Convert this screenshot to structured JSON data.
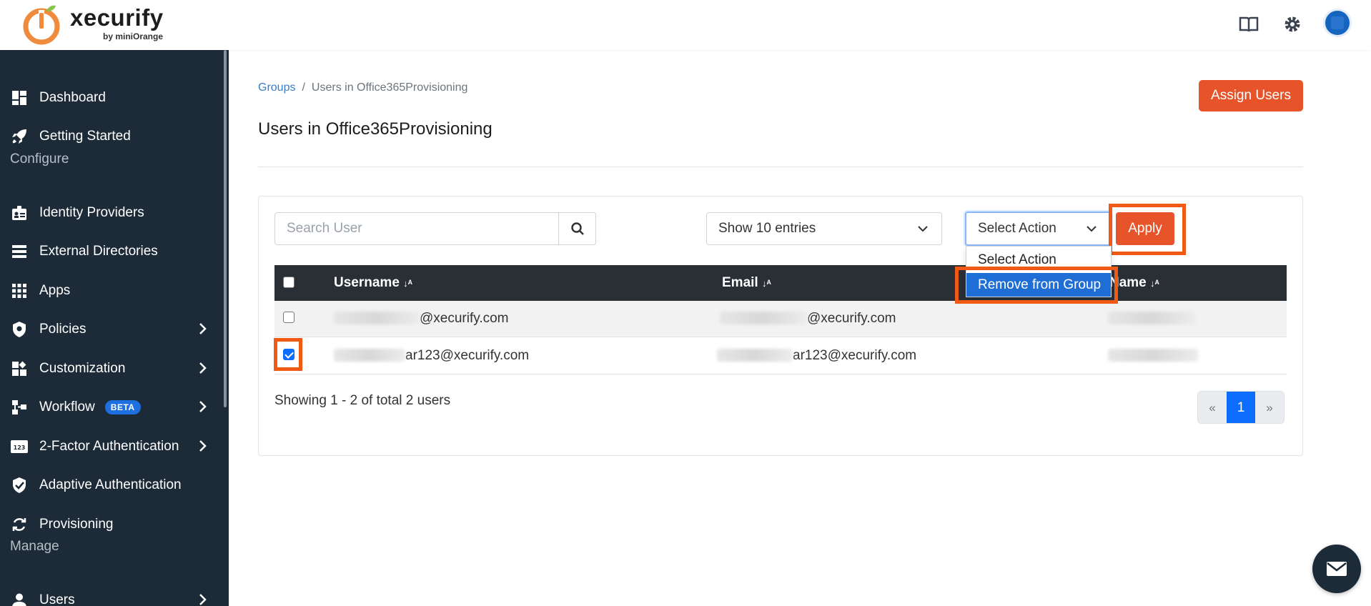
{
  "brand": {
    "name": "xecurify",
    "sub": "by miniOrange"
  },
  "sidebar": {
    "items": [
      {
        "label": "Dashboard",
        "icon": "dashboard-icon"
      },
      {
        "label": "Getting Started",
        "icon": "rocket-icon"
      },
      {
        "label": "Identity Providers",
        "icon": "id-badge-icon"
      },
      {
        "label": "External Directories",
        "icon": "list-icon"
      },
      {
        "label": "Apps",
        "icon": "grid-icon"
      },
      {
        "label": "Policies",
        "icon": "shield-lock-icon"
      },
      {
        "label": "Customization",
        "icon": "widgets-icon"
      },
      {
        "label": "Workflow",
        "icon": "workflow-icon",
        "badge": "BETA"
      },
      {
        "label": "2-Factor Authentication",
        "icon": "123-icon"
      },
      {
        "label": "Adaptive Authentication",
        "icon": "shield-check-icon"
      },
      {
        "label": "Provisioning",
        "icon": "sync-icon"
      },
      {
        "label": "Users",
        "icon": "user-icon"
      }
    ],
    "sections": {
      "configure": "Configure",
      "manage": "Manage"
    }
  },
  "breadcrumb": {
    "parent": "Groups",
    "separator": "/",
    "current": "Users in Office365Provisioning"
  },
  "page": {
    "title": "Users in Office365Provisioning",
    "assign_label": "Assign Users"
  },
  "toolbar": {
    "search_placeholder": "Search User",
    "entries_label": "Show 10 entries",
    "action_label": "Select Action",
    "apply_label": "Apply"
  },
  "dropdown": {
    "options": [
      "Select Action",
      "Remove from Group"
    ],
    "selected": "Remove from Group"
  },
  "table": {
    "headers": {
      "username": "Username",
      "email": "Email",
      "name": "Name"
    },
    "rows": [
      {
        "username": "@xecurify.com",
        "email": "@xecurify.com",
        "checked": false
      },
      {
        "username": "ar123@xecurify.com",
        "email": "ar123@xecurify.com",
        "checked": true
      }
    ]
  },
  "footer": {
    "showing": "Showing 1 - 2 of total 2 users"
  },
  "pagination": {
    "prev": "«",
    "current": "1",
    "next": "»"
  },
  "colors": {
    "accent": "#e8542a",
    "sidebar": "#1d2a38",
    "primary": "#0d6efd",
    "highlight": "#f05a14"
  }
}
